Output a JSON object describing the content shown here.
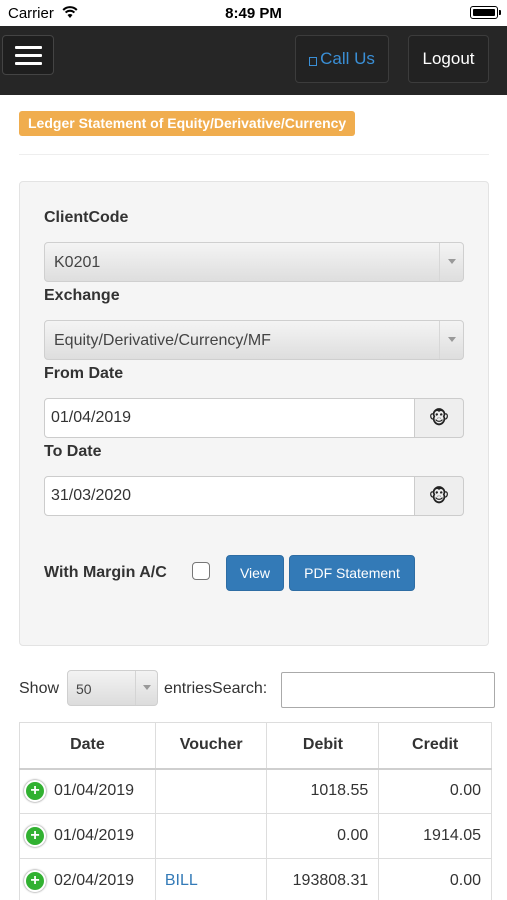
{
  "status_bar": {
    "carrier": "Carrier",
    "time": "8:49 PM"
  },
  "navbar": {
    "call_label": "Call Us",
    "logout_label": "Logout"
  },
  "page_title": "Ledger Statement of Equity/Derivative/Currency",
  "form": {
    "client_code_label": "ClientCode",
    "client_code_value": "K0201",
    "exchange_label": "Exchange",
    "exchange_value": "Equity/Derivative/Currency/MF",
    "from_date_label": "From Date",
    "from_date_value": "01/04/2019",
    "to_date_label": "To Date",
    "to_date_value": "31/03/2020",
    "calendar_icon": "🐵",
    "margin_label": "With Margin A/C",
    "view_button": "View",
    "pdf_button": "PDF Statement"
  },
  "table_controls": {
    "show_label": "Show",
    "page_length": "50",
    "entries_search_label": "entriesSearch:"
  },
  "table": {
    "headers": [
      "Date",
      "Voucher",
      "Debit",
      "Credit"
    ],
    "rows": [
      {
        "date": "01/04/2019",
        "voucher": "",
        "debit": "1018.55",
        "credit": "0.00"
      },
      {
        "date": "01/04/2019",
        "voucher": "",
        "debit": "0.00",
        "credit": "1914.05"
      },
      {
        "date": "02/04/2019",
        "voucher": "BILL",
        "debit": "193808.31",
        "credit": "0.00"
      }
    ],
    "expand_symbol": "+"
  },
  "colors": {
    "navbar": "#262626",
    "badge": "#f0ad4e",
    "primary": "#337ab7",
    "expand": "#31b131"
  }
}
